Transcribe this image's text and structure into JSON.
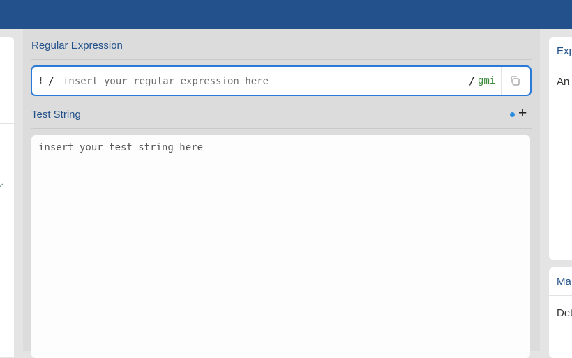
{
  "regex_panel": {
    "title": "Regular Expression",
    "placeholder": "insert your regular expression here",
    "value": "",
    "delimiter_open": "/",
    "delimiter_close": "/",
    "flags": "gmi",
    "handle_icon": "drag-handle-icon",
    "copy_icon": "copy-icon"
  },
  "test_panel": {
    "title": "Test String",
    "placeholder": "insert your test string here",
    "value": "",
    "add_icon": "plus-icon",
    "status_dot_color": "#2a8de0"
  },
  "right_panel": {
    "explanation_title": "Exp",
    "explanation_body": "An",
    "match_title": "Ma",
    "match_body": "Det"
  },
  "colors": {
    "header": "#23518b",
    "accent": "#2a7ad8",
    "flags": "#3b8a3b",
    "section_title": "#23518b"
  }
}
